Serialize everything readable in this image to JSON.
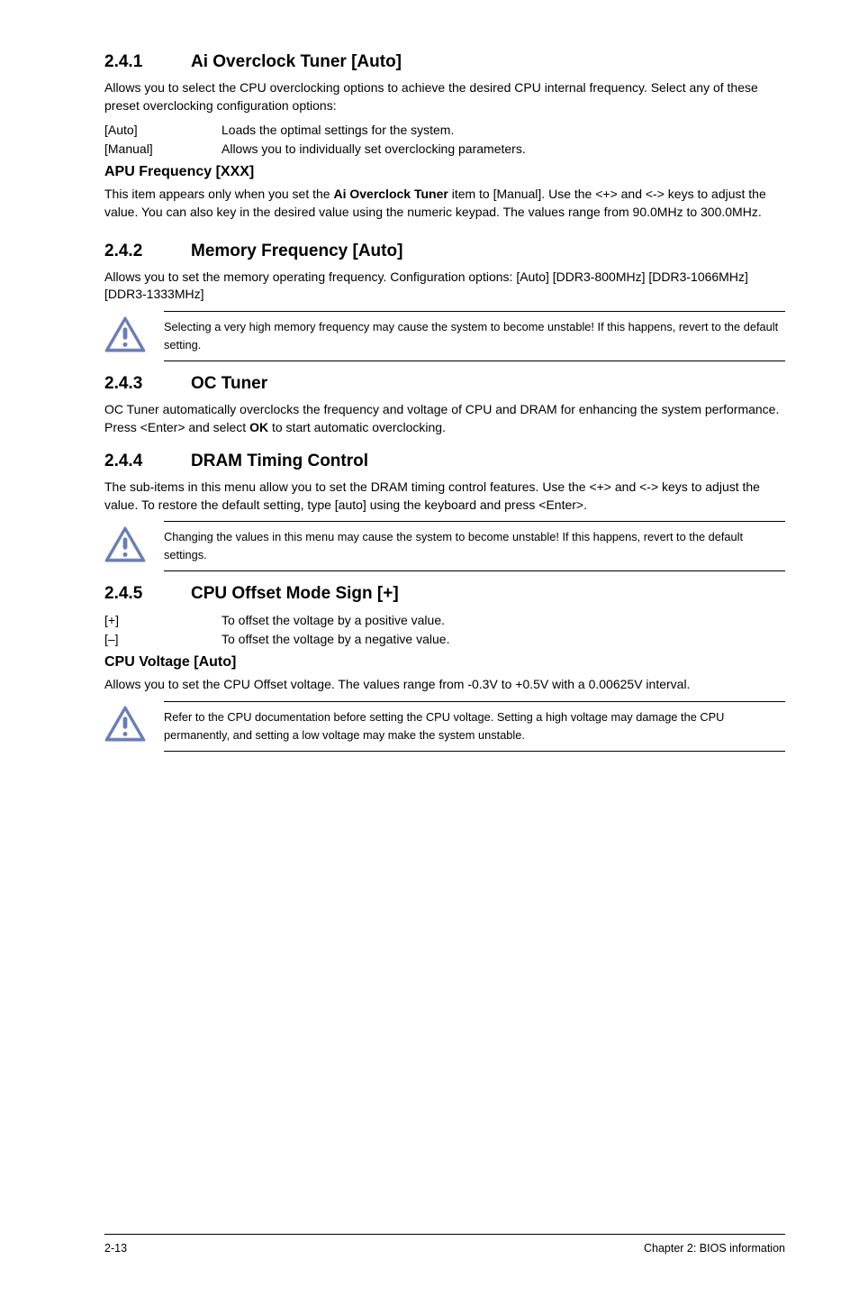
{
  "s241": {
    "num": "2.4.1",
    "title": "Ai Overclock Tuner [Auto]",
    "p1": "Allows you to select the CPU overclocking options to achieve the desired CPU internal frequency. Select any of these preset overclocking configuration options:",
    "opts": [
      {
        "term": "[Auto]",
        "desc": "Loads the optimal settings for the system."
      },
      {
        "term": "[Manual]",
        "desc": "Allows you to individually set overclocking parameters."
      }
    ],
    "sub1_title": "APU Frequency [XXX]",
    "sub1_p_pre": "This item appears only when you set the ",
    "sub1_p_bold": "Ai Overclock Tuner",
    "sub1_p_post": " item to [Manual]. Use the <+> and <-> keys to adjust the value. You can also key in the desired value using the numeric keypad. The values range from 90.0MHz to 300.0MHz."
  },
  "s242": {
    "num": "2.4.2",
    "title": "Memory Frequency [Auto]",
    "p1": "Allows you to set the memory operating frequency. Configuration options: [Auto] [DDR3-800MHz] [DDR3-1066MHz] [DDR3-1333MHz]",
    "note": "Selecting a very high memory frequency may cause the system to become unstable! If this happens, revert to the default setting."
  },
  "s243": {
    "num": "2.4.3",
    "title": "OC Tuner",
    "p1_pre": "OC Tuner automatically overclocks the frequency and voltage of CPU and DRAM for enhancing the system performance. Press <Enter> and select ",
    "p1_bold": "OK",
    "p1_post": " to start automatic overclocking."
  },
  "s244": {
    "num": "2.4.4",
    "title": "DRAM Timing Control",
    "p1": "The sub-items in this menu allow you to set the DRAM timing control features. Use the <+> and <-> keys to adjust the value. To restore the default setting, type [auto] using the keyboard and press <Enter>.",
    "note": "Changing the values in this menu may cause the system to become unstable! If this happens, revert to the default settings."
  },
  "s245": {
    "num": "2.4.5",
    "title": "CPU Offset Mode Sign [+]",
    "opts": [
      {
        "term": "[+]",
        "desc": "To offset the voltage by a positive value."
      },
      {
        "term": "[–]",
        "desc": "To offset the voltage by a negative value."
      }
    ],
    "sub1_title": "CPU Voltage [Auto]",
    "sub1_p": "Allows you to set the CPU Offset voltage. The values range from -0.3V to +0.5V with a 0.00625V interval.",
    "note": "Refer to the CPU documentation before setting the CPU voltage. Setting a high voltage may damage the CPU permanently, and setting a low voltage may make the system unstable."
  },
  "footer": {
    "left": "2-13",
    "right": "Chapter 2: BIOS information"
  },
  "icons": {
    "caution": "caution"
  }
}
